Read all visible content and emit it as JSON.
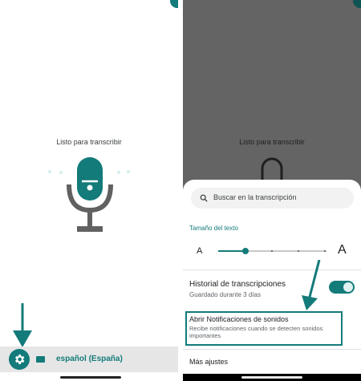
{
  "left": {
    "status_text": "Listo para transcribir",
    "language_label": "español (España)",
    "icons": [
      "settings-gear-icon",
      "keyboard-icon",
      "microphone-icon"
    ],
    "accent_color": "#137b7a"
  },
  "right": {
    "status_text": "Listo para transcribir",
    "search": {
      "placeholder": "Buscar en la transcripción"
    },
    "text_size": {
      "title": "Tamaño del texto",
      "small_label": "A",
      "large_label": "A",
      "value_fraction": 0.25
    },
    "history": {
      "title": "Historial de transcripciones",
      "subtitle": "Guardado durante 3 días",
      "enabled": true
    },
    "notifications": {
      "title": "Abrir Notificaciones de sonidos",
      "subtitle": "Recibe notificaciones cuando se detecten sonidos importantes"
    },
    "more_settings": "Más ajustes"
  }
}
